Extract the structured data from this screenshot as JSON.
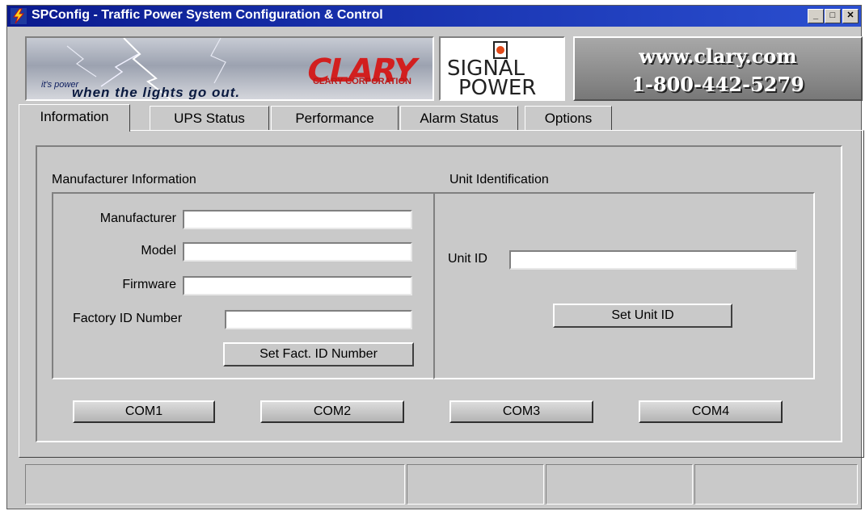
{
  "window": {
    "title": "SPConfig - Traffic Power System Configuration & Control",
    "minimize_glyph": "_",
    "maximize_glyph": "□",
    "close_glyph": "✕"
  },
  "banner": {
    "clary_logo": "CLARY",
    "clary_corporation": "CLARY CORPORATION",
    "tagline_small": "it's power",
    "tagline_large": "when the lights go out.",
    "signal_line1": "SIGNAL",
    "signal_line2": "POWER",
    "url": "www.clary.com",
    "phone": "1-800-442-5279"
  },
  "tabs": [
    {
      "label": "Information",
      "active": true
    },
    {
      "label": "UPS Status",
      "active": false
    },
    {
      "label": "Performance",
      "active": false
    },
    {
      "label": "Alarm Status",
      "active": false
    },
    {
      "label": "Options",
      "active": false
    }
  ],
  "manufacturer_info": {
    "heading": "Manufacturer Information",
    "manufacturer_label": "Manufacturer",
    "manufacturer_value": "",
    "model_label": "Model",
    "model_value": "",
    "firmware_label": "Firmware",
    "firmware_value": "",
    "factory_id_label": "Factory ID Number",
    "factory_id_value": "",
    "set_factory_id_button": "Set Fact. ID Number"
  },
  "unit_identification": {
    "heading": "Unit Identification",
    "unit_id_label": "Unit ID",
    "unit_id_value": "",
    "set_unit_id_button": "Set Unit ID"
  },
  "com_ports": [
    "COM1",
    "COM2",
    "COM3",
    "COM4"
  ],
  "status_panes": [
    "",
    "",
    "",
    ""
  ],
  "colors": {
    "titlebar": "#0a1a8e",
    "window_bg": "#c9c9c9",
    "clary_red": "#d21f1f"
  },
  "icons": {
    "app": "app-lightning-icon"
  }
}
